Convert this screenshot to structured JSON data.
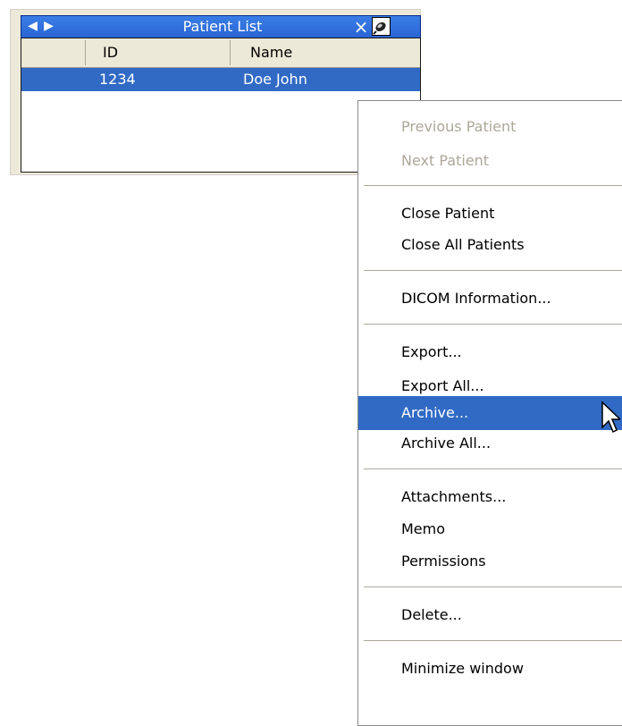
{
  "patient_list": {
    "title": "Patient List",
    "nav_back_glyph": "◀",
    "nav_forward_glyph": "▶",
    "close_glyph": "×",
    "columns": [
      "ID",
      "Name"
    ],
    "rows": [
      {
        "id": "1234",
        "name": "Doe John",
        "selected": true
      }
    ]
  },
  "context_menu": {
    "items": [
      {
        "label": "Previous Patient",
        "enabled": false
      },
      {
        "label": "Next Patient",
        "enabled": false
      },
      {
        "separator": true
      },
      {
        "label": "Close Patient",
        "enabled": true
      },
      {
        "label": "Close All Patients",
        "enabled": true
      },
      {
        "separator": true
      },
      {
        "label": "DICOM Information...",
        "enabled": true
      },
      {
        "separator": true
      },
      {
        "label": "Export...",
        "enabled": true
      },
      {
        "label": "Export All...",
        "enabled": true
      },
      {
        "separator": true
      },
      {
        "label": "Archive...",
        "enabled": true,
        "highlighted": true
      },
      {
        "label": "Archive All...",
        "enabled": true
      },
      {
        "separator": true
      },
      {
        "label": "Attachments...",
        "enabled": true
      },
      {
        "label": "Memo",
        "enabled": true
      },
      {
        "label": "Permissions",
        "enabled": true
      },
      {
        "separator": true
      },
      {
        "label": "Delete...",
        "enabled": true
      },
      {
        "separator": true
      },
      {
        "label": "Minimize window",
        "enabled": true
      }
    ]
  },
  "colors": {
    "selection": "#316ac5",
    "disabled_text": "#aca899",
    "titlebar": "#2a64d4"
  }
}
